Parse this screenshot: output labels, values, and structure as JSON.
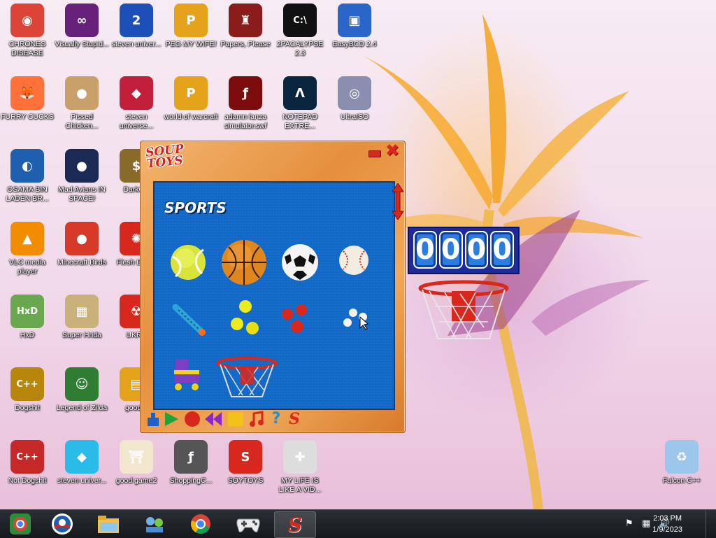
{
  "desktop": {
    "icons": [
      {
        "label": "CHRONES DISEASE",
        "icon": "chrome-icon",
        "color": "#db4437"
      },
      {
        "label": "Visually Stupid...",
        "icon": "visual-studio-icon",
        "color": "#68217a"
      },
      {
        "label": "steven univer...",
        "icon": "number-2-icon",
        "color": "#1c4fb8"
      },
      {
        "label": "PEG MY WIFE!",
        "icon": "peggle-icon",
        "color": "#e5a21b"
      },
      {
        "label": "Papers, Please",
        "icon": "eagle-emblem-icon",
        "color": "#8a1c1c"
      },
      {
        "label": "2PACALYPSE 2.3",
        "icon": "console-icon",
        "color": "#111111"
      },
      {
        "label": "EasyBCD 2.4",
        "icon": "easybcd-icon",
        "color": "#2a66c9"
      },
      {
        "label": "FURRY CUCKS",
        "icon": "firefox-icon",
        "color": "#ff7139"
      },
      {
        "label": "Pissed Chicken...",
        "icon": "angry-birds-seasons-icon",
        "color": "#c9a06a"
      },
      {
        "label": "steven universe...",
        "icon": "diamond-ring-icon",
        "color": "#c21f3a"
      },
      {
        "label": "world of warcraft",
        "icon": "peggle-icon",
        "color": "#e5a21b"
      },
      {
        "label": "adamn lanza simulator.swf",
        "icon": "flash-icon",
        "color": "#7d0d0d"
      },
      {
        "label": "NOTEPAD EXTRE...",
        "icon": "notepad-extreme-icon",
        "color": "#0a2540"
      },
      {
        "label": "UltraISO",
        "icon": "disc-icon",
        "color": "#8a8fb0"
      },
      {
        "label": "OSAMA BIN LADEN BR...",
        "icon": "obama-logo-icon",
        "color": "#1f5fb0"
      },
      {
        "label": "Mad Avians IN SPACE!",
        "icon": "angry-birds-space-icon",
        "color": "#1a2a55"
      },
      {
        "label": "DarkOK",
        "icon": "money-bag-icon",
        "color": "#8a6a2a"
      },
      {
        "label": "VLC media player",
        "icon": "vlc-cone-icon",
        "color": "#f28c00"
      },
      {
        "label": "Minecraft Birds",
        "icon": "angry-bird-icon",
        "color": "#d83a2a"
      },
      {
        "label": "Flesh DELU",
        "icon": "red-creature-icon",
        "color": "#d8271c"
      },
      {
        "label": "HxD",
        "icon": "hxd-icon",
        "color": "#6aa84f"
      },
      {
        "label": "Super Hrida",
        "icon": "pixel-art-icon",
        "color": "#c9b27a"
      },
      {
        "label": "UKRA",
        "icon": "radiation-icon",
        "color": "#d8271c"
      },
      {
        "label": "Dogshit",
        "icon": "cpp-compiler-icon",
        "color": "#b8860b"
      },
      {
        "label": "Legend of Zilda",
        "icon": "pixel-hero-icon",
        "color": "#2e7d32"
      },
      {
        "label": "good g",
        "icon": "game-box-icon",
        "color": "#e5a21b"
      },
      {
        "label": "Not Dogshit",
        "icon": "dev-cpp-icon",
        "color": "#c62828"
      },
      {
        "label": "steven univer...",
        "icon": "blue-diamond-icon",
        "color": "#2bbbe8"
      },
      {
        "label": "good game2",
        "icon": "torii-gate-icon",
        "color": "#f2e6cf"
      },
      {
        "label": "ShoppingC...",
        "icon": "flash-player-icon",
        "color": "#555555"
      },
      {
        "label": "SOYTOYS",
        "icon": "soup-s-icon",
        "color": "#d8271c"
      },
      {
        "label": "MY LIFE IS LIKE A VID...",
        "icon": "gamepad-icon",
        "color": "#dddddd"
      },
      {
        "label": "Falcon C++",
        "icon": "recycle-bin-icon",
        "color": "#9cc6ea"
      }
    ]
  },
  "soup_window": {
    "logo_line1": "SOUP",
    "logo_line2": "TOYS",
    "category": "SPORTS",
    "toys": [
      "tennis-ball",
      "basketball",
      "soccer-ball",
      "baseball",
      "pogo-stick",
      "juggling-balls",
      "red-balls",
      "white-balls",
      "roller-skate",
      "basketball-hoop"
    ],
    "toolbar": [
      "weight-icon",
      "play-icon",
      "record-icon",
      "rewind-icon",
      "stop-icon",
      "music-note-icon",
      "help-icon",
      "soup-s-icon"
    ]
  },
  "score": {
    "digits": [
      "0",
      "0",
      "0",
      "0"
    ]
  },
  "taskbar": {
    "apps": [
      "start-orb",
      "obama-logo-icon",
      "file-explorer-icon",
      "network-people-icon",
      "chrome-icon",
      "gamepad-icon",
      "soup-s-icon"
    ],
    "active_app": "soup-s-icon",
    "clock_time": "2:03 PM",
    "clock_date": "1/9/2023"
  },
  "colors": {
    "panel_blue": "#1268c6",
    "soup_red": "#d8271c",
    "frame_orange": "#e58f3d"
  }
}
